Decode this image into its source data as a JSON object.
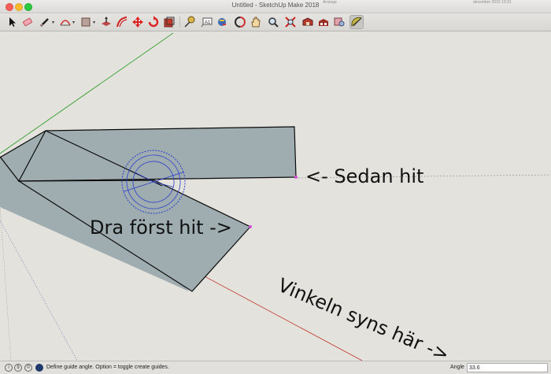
{
  "window": {
    "title": "Untitled - SketchUp Make 2018"
  },
  "background": {
    "menu_fragment": "Arrange",
    "clock_fragment": "december 2015 10:31"
  },
  "toolbar": {
    "tools": [
      {
        "name": "select-tool",
        "icon": "arrow-cursor-icon"
      },
      {
        "name": "eraser-tool",
        "icon": "eraser-icon"
      },
      {
        "name": "line-tool",
        "icon": "pencil-icon",
        "dropdown": true
      },
      {
        "name": "arc-tool",
        "icon": "arc-icon",
        "dropdown": true
      },
      {
        "name": "shape-tool",
        "icon": "rectangle-icon",
        "dropdown": true
      },
      {
        "name": "push-pull-tool",
        "icon": "push-pull-icon"
      },
      {
        "name": "offset-tool",
        "icon": "offset-icon"
      },
      {
        "name": "move-tool",
        "icon": "move-arrows-icon"
      },
      {
        "name": "rotate-tool",
        "icon": "rotate-icon"
      },
      {
        "name": "scale-tool",
        "icon": "scale-icon"
      },
      {
        "name": "tape-measure-tool",
        "icon": "tape-measure-icon"
      },
      {
        "name": "text-tool",
        "icon": "text-icon"
      },
      {
        "name": "paint-bucket-tool",
        "icon": "paint-bucket-icon"
      },
      {
        "name": "orbit-tool",
        "icon": "orbit-icon"
      },
      {
        "name": "pan-tool",
        "icon": "hand-icon"
      },
      {
        "name": "zoom-tool",
        "icon": "magnifier-icon"
      },
      {
        "name": "zoom-extents-tool",
        "icon": "zoom-extents-icon"
      },
      {
        "name": "warehouse-tool",
        "icon": "3d-warehouse-icon"
      },
      {
        "name": "extension-warehouse-tool",
        "icon": "extension-warehouse-icon"
      },
      {
        "name": "layout-tool",
        "icon": "layout-icon"
      },
      {
        "name": "protractor-tool",
        "icon": "protractor-icon",
        "active": true
      }
    ]
  },
  "canvas": {
    "annotations": {
      "second": "<- Sedan hit",
      "first": "Dra först hit ->",
      "angle_note": "Vinkeln syns här ->"
    },
    "colors": {
      "face": "#9fadb1",
      "edge": "#0a0a0a",
      "green_axis": "#3fa33a",
      "red_axis": "#c0392b",
      "protractor": "#2b3ec9",
      "endpoint": "#d14fd6",
      "background": "#e4e2dd"
    }
  },
  "statusbar": {
    "message": "Define guide angle.  Option = toggle create guides.",
    "vcb_label": "Angle",
    "vcb_value": "33.6"
  }
}
